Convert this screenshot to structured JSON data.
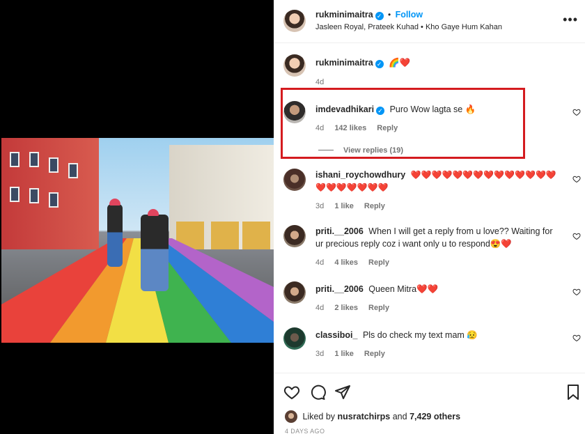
{
  "post": {
    "author": "rukminimaitra",
    "follow_label": "Follow",
    "audio_line": "Jasleen Royal, Prateek Kuhad • Kho Gaye Hum Kahan",
    "more_icon": "more-horizontal-icon"
  },
  "caption": {
    "username": "rukminimaitra",
    "text": "🌈❤️",
    "time": "4d"
  },
  "comments": [
    {
      "username": "imdevadhikari",
      "verified": true,
      "text": "Puro Wow lagta se 🔥",
      "time": "4d",
      "likes": "142 likes",
      "reply": "Reply",
      "view_replies": "View replies (19)"
    },
    {
      "username": "ishani_roychowdhury",
      "verified": false,
      "text": "❤️❤️❤️❤️❤️❤️❤️❤️❤️❤️❤️❤️❤️❤️❤️❤️❤️❤️❤️❤️❤️",
      "time": "3d",
      "likes": "1 like",
      "reply": "Reply"
    },
    {
      "username": "priti.__2006",
      "verified": false,
      "text": "When I will get a reply from u love?? Waiting for ur precious reply coz i want only u to respond😍❤️",
      "time": "4d",
      "likes": "4 likes",
      "reply": "Reply"
    },
    {
      "username": "priti.__2006",
      "verified": false,
      "text": "Queen Mitra❤️❤️",
      "time": "4d",
      "likes": "2 likes",
      "reply": "Reply"
    },
    {
      "username": "classiboi_",
      "verified": false,
      "text": "Pls do check my text mam 😥",
      "time": "3d",
      "likes": "1 like",
      "reply": "Reply"
    }
  ],
  "likes": {
    "prefix": "Liked by",
    "user": "nusratchirps",
    "and": "and",
    "others": "7,429 others"
  },
  "posted_ago": "4 DAYS AGO",
  "colors": {
    "accent": "#0095f6",
    "highlight_box": "#d41b1f",
    "heart_red": "#e0102a"
  }
}
